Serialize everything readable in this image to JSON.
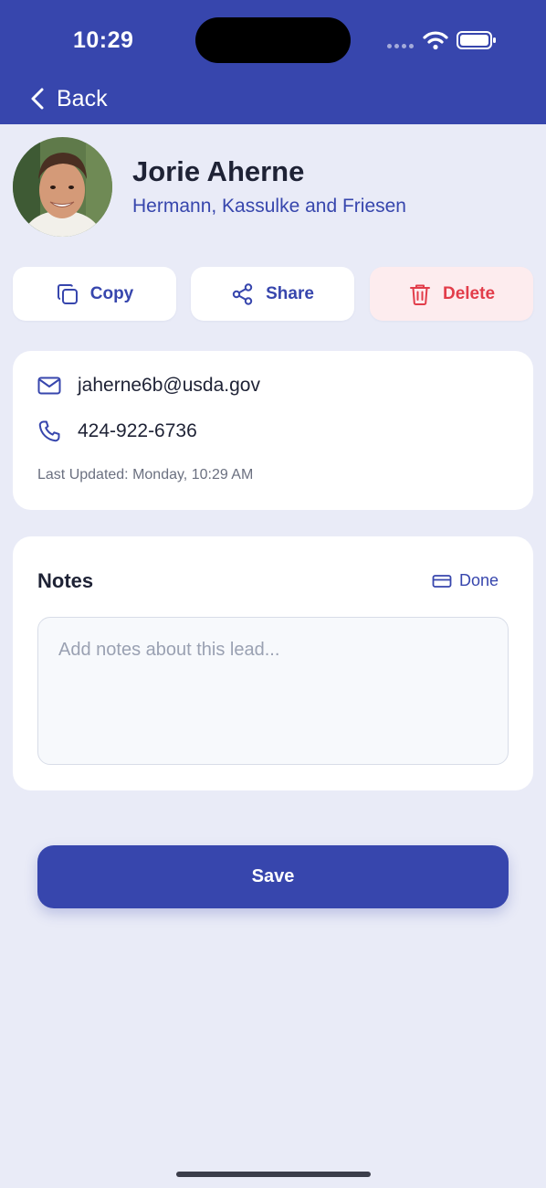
{
  "status_bar": {
    "time": "10:29"
  },
  "nav": {
    "back_label": "Back"
  },
  "lead": {
    "name": "Jorie Aherne",
    "company": "Hermann, Kassulke and Friesen"
  },
  "actions": {
    "copy_label": "Copy",
    "share_label": "Share",
    "delete_label": "Delete"
  },
  "contact": {
    "email": "jaherne6b@usda.gov",
    "phone": "424-922-6736",
    "last_updated": "Last Updated: Monday, 10:29 AM"
  },
  "notes": {
    "title": "Notes",
    "done_label": "Done",
    "value": "",
    "placeholder": "Add notes about this lead..."
  },
  "save_label": "Save",
  "icons": [
    "chevron-left-icon",
    "copy-icon",
    "share-icon",
    "trash-icon",
    "mail-icon",
    "phone-icon",
    "keyboard-icon",
    "wifi-icon",
    "battery-icon"
  ],
  "colors": {
    "primary": "#3746ad",
    "background": "#e9ebf7",
    "danger": "#e23d4a",
    "danger_bg": "#fdecee"
  }
}
